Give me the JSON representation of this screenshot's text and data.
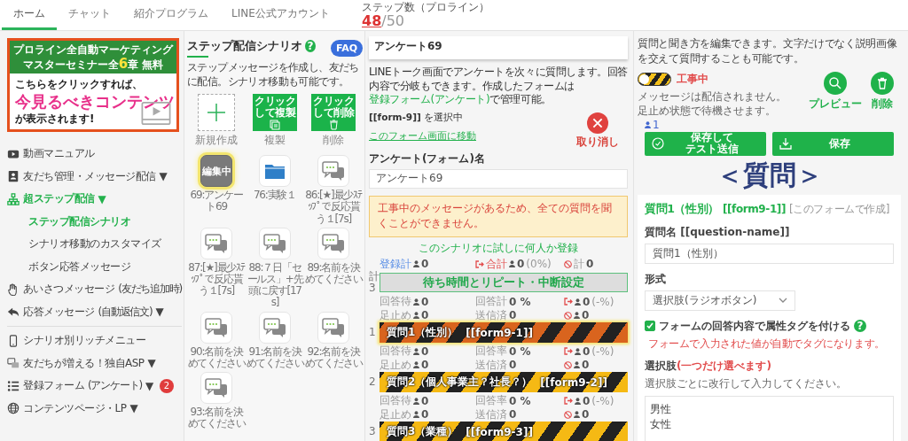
{
  "top_tabs": [
    {
      "label": "ホーム",
      "selected": true
    },
    {
      "label": "チャット",
      "selected": false
    },
    {
      "label": "紹介プログラム",
      "selected": false
    },
    {
      "label": "LINE公式アカウント",
      "selected": false
    }
  ],
  "step_count": {
    "label": "ステップ数（プロライン）",
    "used": "48",
    "limit": "/50"
  },
  "sidebar": {
    "banner": {
      "title_lines": [
        "プロライン全自動マーケティング",
        "マスターセミナー全**6**章 無料"
      ],
      "lead": "こちらをクリックすれば、",
      "highlight": "今見るべきコンテンツ",
      "tail": "が表示されます!"
    },
    "menu_groups": [
      [
        {
          "kind": "video",
          "label": "動画マニュアル",
          "selected": false
        },
        {
          "kind": "contact",
          "label": "友だち管理・メッセージ配信",
          "caret": "▼",
          "selected": false
        },
        {
          "kind": "tree",
          "label": "超ステップ配信",
          "caret": "▼",
          "selected": true,
          "children": [
            {
              "label": "ステップ配信シナリオ",
              "selected": true
            },
            {
              "label": "シナリオ移動のカスタマイズ",
              "selected": false
            },
            {
              "label": "ボタン応答メッセージ",
              "selected": false
            }
          ]
        },
        {
          "kind": "hand",
          "label": "あいさつメッセージ",
          "note": "(友だち追加時)",
          "selected": false
        },
        {
          "kind": "reply",
          "label": "応答メッセージ",
          "note": "(自動返信文)",
          "caret": "▼",
          "selected": false
        }
      ],
      [
        {
          "kind": "phone",
          "label": "シナリオ別リッチメニュー",
          "selected": false
        },
        {
          "kind": "chat",
          "label": "友だちが増える！独自ASP",
          "caret": "▼",
          "selected": false
        },
        {
          "kind": "list",
          "label": "登録フォーム",
          "note": "(アンケート)",
          "caret": "▼",
          "badge": "2",
          "selected": false
        },
        {
          "kind": "globe",
          "label": "コンテンツページ・LP",
          "caret": "▼",
          "selected": false
        }
      ]
    ]
  },
  "scenario_panel": {
    "title": "ステップ配信シナリオ",
    "help": "?",
    "faq": "FAQ",
    "description": "ステップメッセージを作成し、友だちに配信。シナリオ移動も可能です。",
    "actions": [
      {
        "kind": "new",
        "caption": "新規作成"
      },
      {
        "kind": "copy",
        "lines": [
          "クリック",
          "して複製"
        ],
        "caption": "複製"
      },
      {
        "kind": "delete",
        "lines": [
          "クリック",
          "して削除"
        ],
        "caption": "削除"
      }
    ],
    "scenarios": [
      {
        "kind": "editing",
        "badge": "編集中",
        "label": "69:アンケート69",
        "selected": true
      },
      {
        "kind": "folder",
        "label": "76:実験１",
        "selected": false
      },
      {
        "kind": "message",
        "label": "86:[★]最少ｽﾃｯﾌﾟで反応貰う１[7s]",
        "selected": false
      },
      {
        "kind": "message",
        "label": "87:[★]最少ｽﾃｯﾌﾟで反応貰う１[7s]",
        "selected": false
      },
      {
        "kind": "message",
        "label": "88:７日「セールス」+先頭に戻す[17s]",
        "selected": false
      },
      {
        "kind": "message",
        "label": "89:名前を決めてください",
        "selected": false
      },
      {
        "kind": "message",
        "label": "90:名前を決めてください",
        "selected": false
      },
      {
        "kind": "message",
        "label": "91:名前を決めてください",
        "selected": false
      },
      {
        "kind": "message",
        "label": "92:名前を決めてください",
        "selected": false
      },
      {
        "kind": "message",
        "label": "93:名前を決めてください",
        "selected": false
      }
    ]
  },
  "form_panel": {
    "header": "アンケート69",
    "description": {
      "before": "LINEトーク画面でアンケートを次々に質問します。回答内容で分岐もできます。作成したフォームは",
      "link": "登録フォーム(アンケート)",
      "after": "で管理可能。"
    },
    "selection": "**[[form-9]]** を選択中",
    "open_link": "このフォーム画面に移動",
    "cancel": "取り消し",
    "name_label": "アンケート(フォーム)名",
    "name_value": "アンケート69",
    "warning": "工事中のメッセージがあるため、全ての質問を聞くことができません。",
    "trial_link": "このシナリオに試しに何人か登録",
    "totals": [
      {
        "kind": "registered",
        "label": "登録計",
        "person": true,
        "value": "0"
      },
      {
        "kind": "exit",
        "label": "合計",
        "person": true,
        "value": "0",
        "note": "(0%)"
      },
      {
        "kind": "blocked",
        "label": "計",
        "person": false,
        "value": "0"
      }
    ],
    "wait_setting": {
      "index_label": "計",
      "index_number": "3",
      "label": "待ち時間とリピート・中断設定"
    },
    "steps": [
      {
        "stats": [
          [
            {
              "kind": "plain",
              "label": "回答待",
              "person": true,
              "value": "0"
            },
            {
              "kind": "plain",
              "label": "回答計",
              "person": false,
              "value": "0 %"
            },
            {
              "kind": "exit",
              "person": true,
              "value": "0",
              "note": "(-%)"
            }
          ],
          [
            {
              "kind": "plain",
              "label": "足止め",
              "person": true,
              "value": "0"
            },
            {
              "kind": "plain",
              "label": "送信済",
              "person": false,
              "value": "0"
            },
            {
              "kind": "blocked",
              "person": true,
              "value": "0"
            }
          ]
        ],
        "number": "1",
        "title": "質問1（性別）",
        "code": "[[form9-1]]",
        "selected": true
      },
      {
        "stats": [
          [
            {
              "kind": "plain",
              "label": "回答待",
              "person": true,
              "value": "0"
            },
            {
              "kind": "plain",
              "label": "回答率",
              "person": false,
              "value": "0 %"
            },
            {
              "kind": "exit",
              "person": true,
              "value": "0",
              "note": "(-%)"
            }
          ],
          [
            {
              "kind": "plain",
              "label": "足止め",
              "person": true,
              "value": "0"
            },
            {
              "kind": "plain",
              "label": "送信済",
              "person": false,
              "value": "0"
            },
            {
              "kind": "blocked",
              "person": true,
              "value": "0"
            }
          ]
        ],
        "number": "2",
        "title": "質問2（個人事業主？社長？）",
        "code": "[[form9-2]]",
        "selected": false
      },
      {
        "stats": [
          [
            {
              "kind": "plain",
              "label": "回答待",
              "person": true,
              "value": "0"
            },
            {
              "kind": "plain",
              "label": "回答率",
              "person": false,
              "value": "0 %"
            },
            {
              "kind": "exit",
              "person": true,
              "value": "0",
              "note": "(-%)"
            }
          ],
          [
            {
              "kind": "plain",
              "label": "足止め",
              "person": true,
              "value": "0"
            },
            {
              "kind": "plain",
              "label": "送信済",
              "person": false,
              "value": "0"
            },
            {
              "kind": "blocked",
              "person": true,
              "value": "0"
            }
          ]
        ],
        "number": "3",
        "title": "質問3（業種）",
        "code": "[[form9-3]]",
        "selected": false
      }
    ]
  },
  "editor": {
    "description": "質問と聞き方を編集できます。文字だけでなく説明画像を交えて質問することも可能です。",
    "status": {
      "under_construction": true,
      "label": "工事中",
      "note_lines": [
        "メッセージは配信されません。",
        "足止め状態で待機させます。"
      ]
    },
    "preview": "プレビュー",
    "delete": "削除",
    "tester_count": "1",
    "save_test_lines": [
      "保存して",
      "テスト送信"
    ],
    "save": "保存",
    "heading": "＜質問＞",
    "question": {
      "title": "質問1（性別）",
      "code": "[[form9-1]]",
      "origin": "[このフォームで作成]",
      "name_label": "質問名 [[question-name]]",
      "name_value": "質問1（性別）",
      "format_label": "形式",
      "format_value": "選択肢(ラジオボタン)",
      "tag_option": {
        "label": "フォームの回答内容で属性タグを付ける",
        "checked": true
      },
      "help": "?",
      "tag_note": "フォームで入力された値が自動でタグになります。",
      "choices_label": "選択肢",
      "choices_label_note": "(一つだけ選べます)",
      "choices_hint": "選択肢ごとに改行して入力してください。",
      "choices_values": [
        "男性",
        "女性"
      ]
    }
  }
}
